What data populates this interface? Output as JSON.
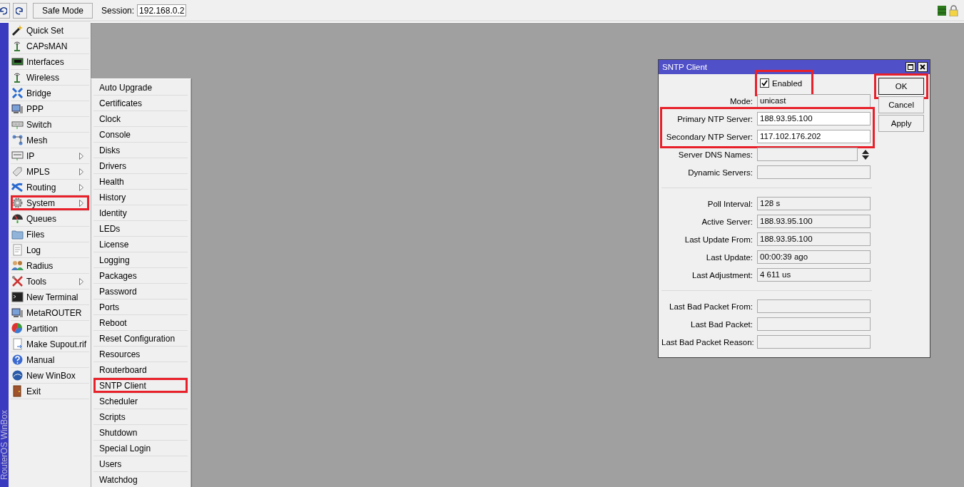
{
  "toolbar": {
    "safe_mode_button": "Safe Mode",
    "session_label": "Session:",
    "session_value": "192.168.0.2"
  },
  "sidebar": {
    "brand": "RouterOS WinBox",
    "items": [
      {
        "label": "Quick Set",
        "submenu": false,
        "highlighted": false
      },
      {
        "label": "CAPsMAN",
        "submenu": false,
        "highlighted": false
      },
      {
        "label": "Interfaces",
        "submenu": false,
        "highlighted": false
      },
      {
        "label": "Wireless",
        "submenu": false,
        "highlighted": false
      },
      {
        "label": "Bridge",
        "submenu": false,
        "highlighted": false
      },
      {
        "label": "PPP",
        "submenu": false,
        "highlighted": false
      },
      {
        "label": "Switch",
        "submenu": false,
        "highlighted": false
      },
      {
        "label": "Mesh",
        "submenu": false,
        "highlighted": false
      },
      {
        "label": "IP",
        "submenu": true,
        "highlighted": false
      },
      {
        "label": "MPLS",
        "submenu": true,
        "highlighted": false
      },
      {
        "label": "Routing",
        "submenu": true,
        "highlighted": false
      },
      {
        "label": "System",
        "submenu": true,
        "highlighted": true
      },
      {
        "label": "Queues",
        "submenu": false,
        "highlighted": false
      },
      {
        "label": "Files",
        "submenu": false,
        "highlighted": false
      },
      {
        "label": "Log",
        "submenu": false,
        "highlighted": false
      },
      {
        "label": "Radius",
        "submenu": false,
        "highlighted": false
      },
      {
        "label": "Tools",
        "submenu": true,
        "highlighted": false
      },
      {
        "label": "New Terminal",
        "submenu": false,
        "highlighted": false
      },
      {
        "label": "MetaROUTER",
        "submenu": false,
        "highlighted": false
      },
      {
        "label": "Partition",
        "submenu": false,
        "highlighted": false
      },
      {
        "label": "Make Supout.rif",
        "submenu": false,
        "highlighted": false
      },
      {
        "label": "Manual",
        "submenu": false,
        "highlighted": false
      },
      {
        "label": "New WinBox",
        "submenu": false,
        "highlighted": false
      },
      {
        "label": "Exit",
        "submenu": false,
        "highlighted": false
      }
    ]
  },
  "submenu": {
    "items": [
      {
        "label": "Auto Upgrade",
        "highlighted": false
      },
      {
        "label": "Certificates",
        "highlighted": false
      },
      {
        "label": "Clock",
        "highlighted": false
      },
      {
        "label": "Console",
        "highlighted": false
      },
      {
        "label": "Disks",
        "highlighted": false
      },
      {
        "label": "Drivers",
        "highlighted": false
      },
      {
        "label": "Health",
        "highlighted": false
      },
      {
        "label": "History",
        "highlighted": false
      },
      {
        "label": "Identity",
        "highlighted": false
      },
      {
        "label": "LEDs",
        "highlighted": false
      },
      {
        "label": "License",
        "highlighted": false
      },
      {
        "label": "Logging",
        "highlighted": false
      },
      {
        "label": "Packages",
        "highlighted": false
      },
      {
        "label": "Password",
        "highlighted": false
      },
      {
        "label": "Ports",
        "highlighted": false
      },
      {
        "label": "Reboot",
        "highlighted": false
      },
      {
        "label": "Reset Configuration",
        "highlighted": false
      },
      {
        "label": "Resources",
        "highlighted": false
      },
      {
        "label": "Routerboard",
        "highlighted": false
      },
      {
        "label": "SNTP Client",
        "highlighted": true
      },
      {
        "label": "Scheduler",
        "highlighted": false
      },
      {
        "label": "Scripts",
        "highlighted": false
      },
      {
        "label": "Shutdown",
        "highlighted": false
      },
      {
        "label": "Special Login",
        "highlighted": false
      },
      {
        "label": "Users",
        "highlighted": false
      },
      {
        "label": "Watchdog",
        "highlighted": false
      }
    ]
  },
  "dialog": {
    "title": "SNTP Client",
    "enabled": {
      "label": "Enabled",
      "checked": true,
      "highlighted": true
    },
    "sections": [
      {
        "separated": false,
        "highlighted": false,
        "rows": [
          {
            "kind": "readonly",
            "label": "Mode:",
            "value": "unicast"
          }
        ]
      },
      {
        "separated": false,
        "highlighted": true,
        "rows": [
          {
            "kind": "text",
            "label": "Primary NTP Server:",
            "value": "188.93.95.100"
          },
          {
            "kind": "text",
            "label": "Secondary NTP Server:",
            "value": "117.102.176.202"
          }
        ]
      },
      {
        "separated": false,
        "highlighted": false,
        "rows": [
          {
            "kind": "spinner",
            "label": "Server DNS Names:"
          },
          {
            "kind": "readonly",
            "label": "Dynamic Servers:"
          }
        ]
      },
      {
        "separated": true,
        "highlighted": false,
        "rows": [
          {
            "kind": "readonly",
            "label": "Poll Interval:",
            "value": "128 s"
          },
          {
            "kind": "readonly",
            "label": "Active Server:",
            "value": "188.93.95.100"
          },
          {
            "kind": "readonly",
            "label": "Last Update From:",
            "value": "188.93.95.100"
          },
          {
            "kind": "readonly",
            "label": "Last Update:",
            "value": "00:00:39 ago"
          },
          {
            "kind": "readonly",
            "label": "Last Adjustment:",
            "value": "4 611 us"
          }
        ]
      },
      {
        "separated": true,
        "highlighted": false,
        "rows": [
          {
            "kind": "readonly",
            "label": "Last Bad Packet From:"
          },
          {
            "kind": "readonly",
            "label": "Last Bad Packet:"
          },
          {
            "kind": "readonly",
            "label": "Last Bad Packet Reason:"
          }
        ]
      }
    ],
    "buttons": [
      {
        "label": "OK",
        "default": true,
        "highlighted": true
      },
      {
        "label": "Cancel",
        "default": false,
        "highlighted": false
      },
      {
        "label": "Apply",
        "default": false,
        "highlighted": false
      }
    ]
  }
}
